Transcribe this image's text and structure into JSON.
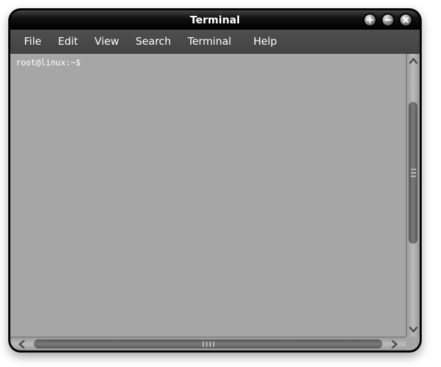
{
  "window": {
    "title": "Terminal"
  },
  "menubar": {
    "items": [
      "File",
      "Edit",
      "View",
      "Search",
      "Terminal",
      "Help"
    ]
  },
  "terminal": {
    "prompt": "root@linux:~$"
  }
}
